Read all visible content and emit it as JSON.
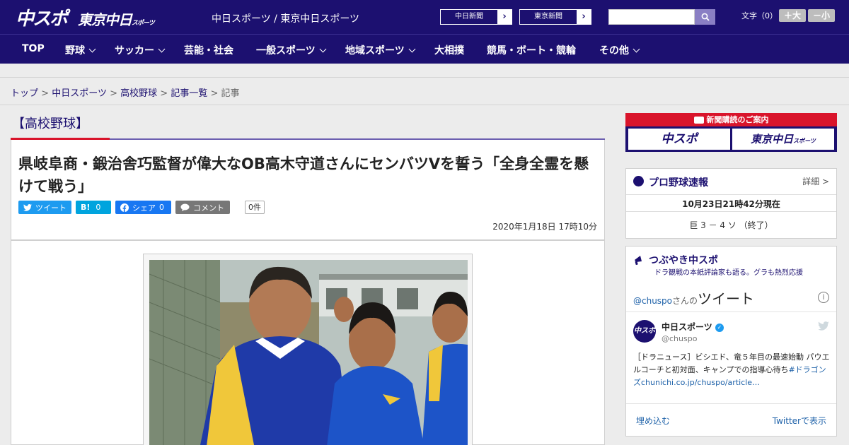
{
  "header": {
    "logo_chuspo": "中スポ",
    "logo_tokyo": "東京中日",
    "logo_tokyo_small": "スポーツ",
    "site_names": "中日スポーツ / 東京中日スポーツ",
    "paper_links": [
      "中日新聞",
      "東京新聞"
    ],
    "search_placeholder": "",
    "font_size_label": "文字（0）",
    "font_larger": "＋大",
    "font_smaller": "－小"
  },
  "nav": {
    "items": [
      {
        "label": "TOP",
        "dropdown": false
      },
      {
        "label": "野球",
        "dropdown": true
      },
      {
        "label": "サッカー",
        "dropdown": true
      },
      {
        "label": "芸能・社会",
        "dropdown": false
      },
      {
        "label": "一般スポーツ",
        "dropdown": true
      },
      {
        "label": "地域スポーツ",
        "dropdown": true
      },
      {
        "label": "大相撲",
        "dropdown": false
      },
      {
        "label": "競馬・ボート・競輪",
        "dropdown": false
      },
      {
        "label": "その他",
        "dropdown": true
      }
    ]
  },
  "breadcrumb": {
    "items": [
      "トップ",
      "中日スポーツ",
      "高校野球",
      "記事一覧"
    ],
    "current": "記事",
    "separator": ">"
  },
  "article": {
    "category": "【高校野球】",
    "title": "県岐阜商・鍛治舎巧監督が偉大なOB高木守道さんにセンバツVを誓う「全身全霊を懸けて戦う」",
    "share": {
      "tweet": "ツイート",
      "hatena": "B!",
      "hatena_count": "0",
      "facebook": "シェア",
      "facebook_count": "0",
      "comment": "コメント",
      "comment_count": "0件"
    },
    "date": "2020年1月18日 17時10分"
  },
  "sidebar": {
    "subscription": {
      "heading": "新聞購読のご案内",
      "chuspo": "中スポ",
      "tokyo": "東京中日",
      "tokyo_small": "スポーツ"
    },
    "baseball": {
      "heading": "プロ野球速報",
      "detail": "詳細 >",
      "time": "10月23日21時42分現在",
      "score": "巨 3 － 4 ソ （終了）"
    },
    "tsubuyaki": {
      "heading": "つぶやき中スポ",
      "subtitle": "ドラ観戦の本紙評論家も語る。グラも熱烈応援",
      "handle_prefix": "@chuspo",
      "handle_suffix": "さんの",
      "tweets_label": "ツイート",
      "user_name": "中日スポーツ",
      "user_handle": "@chuspo",
      "tweet_text": "［ドラニュース］ビシエド、竜５年目の最速始動 パウエルコーチと初対面、キャンプでの指導心待ち",
      "tweet_link": "#ドラゴンズchunichi.co.jp/chuspo/article…",
      "embed": "埋め込む",
      "view_on_twitter": "Twitterで表示"
    }
  },
  "colors": {
    "brand_navy": "#1c1070",
    "accent_red": "#d9142b",
    "twitter": "#1d9bf0",
    "hatena": "#00a4de",
    "facebook": "#1877f2",
    "comment": "#777777"
  }
}
